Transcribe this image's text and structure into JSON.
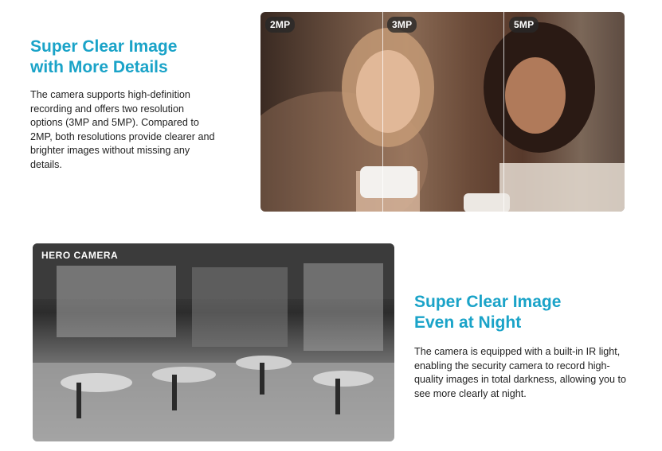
{
  "section_one": {
    "heading": "Super Clear Image\nwith More Details",
    "body": "The camera supports high-definition recording and offers two resolution options (3MP and 5MP). Compared to 2MP, both resolutions provide clearer and brighter images without missing any details.",
    "comparison_labels": [
      "2MP",
      "3MP",
      "5MP"
    ]
  },
  "section_two": {
    "heading": "Super Clear Image\nEven at Night",
    "body": "The camera is equipped with a built-in IR light, enabling the security camera to record high-quality images in total darkness, allowing you to see more clearly at night.",
    "image_label": "HERO CAMERA"
  },
  "colors": {
    "heading": "#1aa3c8",
    "body_text": "#222222",
    "label_pill": "#282828"
  }
}
